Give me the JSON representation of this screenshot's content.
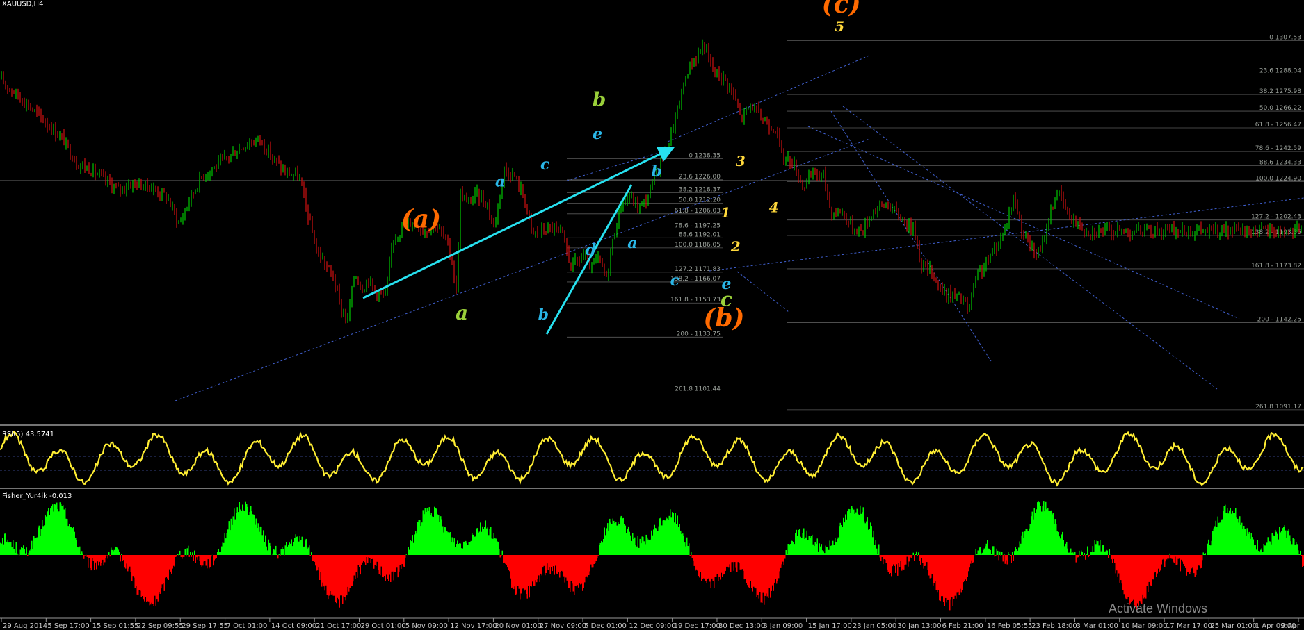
{
  "window": {
    "symbol_title": "XAUUSD,H4"
  },
  "colors": {
    "background": "#000000",
    "bull_candle": "#00c800",
    "bear_candle": "#d01010",
    "fib_line": "#5a5a5a",
    "trend_dotted": "#4060d0",
    "cyan_arrow": "#27e1f0",
    "rsi_line": "#ffee33",
    "fisher_up": "#00ff00",
    "fisher_down": "#ff0000",
    "wave_orange": "#ff6a00",
    "wave_green": "#9ad03a",
    "wave_cyan": "#2ab7e8",
    "wave_yellow": "#ffd83c"
  },
  "chart_data": [
    {
      "type": "candlestick",
      "title": "XAUUSD,H4",
      "xlabel": "",
      "ylabel": "",
      "x_tick_labels": [
        "29 Aug 2014",
        "5 Sep 17:00",
        "15 Sep 01:55",
        "22 Sep 09:55",
        "29 Sep 17:55",
        "7 Oct 01:00",
        "14 Oct 09:00",
        "21 Oct 17:00",
        "29 Oct 01:00",
        "5 Nov 09:00",
        "12 Nov 17:00",
        "20 Nov 01:00",
        "27 Nov 09:00",
        "5 Dec 01:00",
        "12 Dec 09:00",
        "19 Dec 17:00",
        "30 Dec 13:00",
        "8 Jan 09:00",
        "15 Jan 17:00",
        "23 Jan 05:00",
        "30 Jan 13:00",
        "6 Feb 21:00",
        "16 Feb 05:55",
        "23 Feb 18:00",
        "3 Mar 01:00",
        "10 Mar 09:00",
        "17 Mar 17:00",
        "25 Mar 01:00",
        "1 Apr 09:00",
        "9 Apr"
      ],
      "y_range": [
        1085,
        1320
      ],
      "price_path": [
        {
          "x": 0,
          "y": 1285
        },
        {
          "x": 35,
          "y": 1272
        },
        {
          "x": 50,
          "y": 1266
        },
        {
          "x": 70,
          "y": 1258
        },
        {
          "x": 90,
          "y": 1250
        },
        {
          "x": 110,
          "y": 1236
        },
        {
          "x": 130,
          "y": 1232
        },
        {
          "x": 150,
          "y": 1226
        },
        {
          "x": 170,
          "y": 1220
        },
        {
          "x": 190,
          "y": 1224
        },
        {
          "x": 215,
          "y": 1222
        },
        {
          "x": 240,
          "y": 1216
        },
        {
          "x": 258,
          "y": 1200
        },
        {
          "x": 272,
          "y": 1214
        },
        {
          "x": 290,
          "y": 1228
        },
        {
          "x": 310,
          "y": 1234
        },
        {
          "x": 330,
          "y": 1240
        },
        {
          "x": 350,
          "y": 1246
        },
        {
          "x": 373,
          "y": 1250
        },
        {
          "x": 390,
          "y": 1240
        },
        {
          "x": 410,
          "y": 1230
        },
        {
          "x": 430,
          "y": 1228
        },
        {
          "x": 440,
          "y": 1210
        },
        {
          "x": 455,
          "y": 1185
        },
        {
          "x": 470,
          "y": 1175
        },
        {
          "x": 480,
          "y": 1168
        },
        {
          "x": 490,
          "y": 1150
        },
        {
          "x": 500,
          "y": 1144
        },
        {
          "x": 510,
          "y": 1172
        },
        {
          "x": 520,
          "y": 1162
        },
        {
          "x": 530,
          "y": 1168
        },
        {
          "x": 540,
          "y": 1160
        },
        {
          "x": 555,
          "y": 1158
        },
        {
          "x": 565,
          "y": 1192
        },
        {
          "x": 580,
          "y": 1198
        },
        {
          "x": 595,
          "y": 1202
        },
        {
          "x": 610,
          "y": 1196
        },
        {
          "x": 625,
          "y": 1200
        },
        {
          "x": 640,
          "y": 1192
        },
        {
          "x": 650,
          "y": 1178
        },
        {
          "x": 656,
          "y": 1160
        },
        {
          "x": 662,
          "y": 1218
        },
        {
          "x": 672,
          "y": 1212
        },
        {
          "x": 685,
          "y": 1218
        },
        {
          "x": 700,
          "y": 1212
        },
        {
          "x": 710,
          "y": 1198
        },
        {
          "x": 725,
          "y": 1232
        },
        {
          "x": 740,
          "y": 1228
        },
        {
          "x": 755,
          "y": 1214
        },
        {
          "x": 765,
          "y": 1194
        },
        {
          "x": 780,
          "y": 1196
        },
        {
          "x": 795,
          "y": 1198
        },
        {
          "x": 810,
          "y": 1192
        },
        {
          "x": 820,
          "y": 1176
        },
        {
          "x": 830,
          "y": 1178
        },
        {
          "x": 840,
          "y": 1182
        },
        {
          "x": 850,
          "y": 1174
        },
        {
          "x": 860,
          "y": 1180
        },
        {
          "x": 872,
          "y": 1168
        },
        {
          "x": 880,
          "y": 1188
        },
        {
          "x": 893,
          "y": 1212
        },
        {
          "x": 905,
          "y": 1216
        },
        {
          "x": 918,
          "y": 1210
        },
        {
          "x": 930,
          "y": 1214
        },
        {
          "x": 945,
          "y": 1232
        },
        {
          "x": 960,
          "y": 1246
        },
        {
          "x": 975,
          "y": 1268
        },
        {
          "x": 990,
          "y": 1292
        },
        {
          "x": 1005,
          "y": 1300
        },
        {
          "x": 1012,
          "y": 1306
        },
        {
          "x": 1025,
          "y": 1290
        },
        {
          "x": 1040,
          "y": 1286
        },
        {
          "x": 1055,
          "y": 1276
        },
        {
          "x": 1065,
          "y": 1262
        },
        {
          "x": 1080,
          "y": 1270
        },
        {
          "x": 1095,
          "y": 1262
        },
        {
          "x": 1115,
          "y": 1256
        },
        {
          "x": 1125,
          "y": 1240
        },
        {
          "x": 1140,
          "y": 1236
        },
        {
          "x": 1155,
          "y": 1222
        },
        {
          "x": 1170,
          "y": 1230
        },
        {
          "x": 1185,
          "y": 1228
        },
        {
          "x": 1195,
          "y": 1206
        },
        {
          "x": 1210,
          "y": 1208
        },
        {
          "x": 1225,
          "y": 1198
        },
        {
          "x": 1240,
          "y": 1196
        },
        {
          "x": 1255,
          "y": 1208
        },
        {
          "x": 1275,
          "y": 1212
        },
        {
          "x": 1295,
          "y": 1204
        },
        {
          "x": 1315,
          "y": 1196
        },
        {
          "x": 1325,
          "y": 1176
        },
        {
          "x": 1340,
          "y": 1172
        },
        {
          "x": 1355,
          "y": 1160
        },
        {
          "x": 1370,
          "y": 1158
        },
        {
          "x": 1385,
          "y": 1156
        },
        {
          "x": 1392,
          "y": 1148
        },
        {
          "x": 1405,
          "y": 1170
        },
        {
          "x": 1420,
          "y": 1178
        },
        {
          "x": 1440,
          "y": 1192
        },
        {
          "x": 1458,
          "y": 1216
        },
        {
          "x": 1470,
          "y": 1196
        },
        {
          "x": 1485,
          "y": 1184
        },
        {
          "x": 1495,
          "y": 1182
        },
        {
          "x": 1510,
          "y": 1206
        },
        {
          "x": 1520,
          "y": 1220
        },
        {
          "x": 1535,
          "y": 1206
        },
        {
          "x": 1550,
          "y": 1200
        },
        {
          "x": 1565,
          "y": 1196
        }
      ],
      "fib_retracements": [
        {
          "levels": [
            {
              "text": "0 1238.35",
              "price": 1238.35
            },
            {
              "text": "23.6 1226.00",
              "price": 1226.0
            },
            {
              "text": "38.2 1218.37",
              "price": 1218.37
            },
            {
              "text": "50.0 1212.20",
              "price": 1212.2
            },
            {
              "text": "61.8 - 1206.03",
              "price": 1206.03
            },
            {
              "text": "78.6 - 1197.25",
              "price": 1197.25
            },
            {
              "text": "88.6 1192.01",
              "price": 1192.01
            },
            {
              "text": "100.0 1186.05",
              "price": 1186.05
            },
            {
              "text": "127.2 1171.83",
              "price": 1171.83
            },
            {
              "text": "138.2 - 1166.07",
              "price": 1166.07
            },
            {
              "text": "161.8 - 1153.73",
              "price": 1153.73
            },
            {
              "text": "200 - 1133.75",
              "price": 1133.75
            },
            {
              "text": "261.8 1101.44",
              "price": 1101.44
            }
          ]
        },
        {
          "levels": [
            {
              "text": "0 1307.53",
              "price": 1307.53
            },
            {
              "text": "23.6 1288.04",
              "price": 1288.04
            },
            {
              "text": "38.2 1275.98",
              "price": 1275.98
            },
            {
              "text": "50.0 1266.22",
              "price": 1266.22
            },
            {
              "text": "61.8 - 1256.47",
              "price": 1256.47
            },
            {
              "text": "78.6 - 1242.59",
              "price": 1242.59
            },
            {
              "text": "88.6 1234.33",
              "price": 1234.33
            },
            {
              "text": "100.0 1224.90",
              "price": 1224.9
            },
            {
              "text": "127.2 - 1202.43",
              "price": 1202.43
            },
            {
              "text": "138.2 - 1193.35",
              "price": 1193.35
            },
            {
              "text": "161.8 - 1173.82",
              "price": 1173.82
            },
            {
              "text": "200 - 1142.25",
              "price": 1142.25
            },
            {
              "text": "261.8 1091.17",
              "price": 1091.17
            }
          ]
        }
      ],
      "wave_labels": [
        {
          "text": "(a)",
          "color": "#ff6a00",
          "x": 506,
          "y": 1198
        },
        {
          "text": "(b)",
          "color": "#ff6a00",
          "x": 870,
          "y": 1140
        },
        {
          "text": "(c)",
          "color": "#ff6a00",
          "x": 1011,
          "y": 1324
        },
        {
          "text": "a",
          "color": "#9ad03a",
          "x": 555,
          "y": 1144
        },
        {
          "text": "b",
          "color": "#9ad03a",
          "x": 720,
          "y": 1269
        },
        {
          "text": "c",
          "color": "#9ad03a",
          "x": 873,
          "y": 1152
        },
        {
          "text": "a",
          "color": "#2ab7e8",
          "x": 601,
          "y": 1222
        },
        {
          "text": "b",
          "color": "#2ab7e8",
          "x": 653,
          "y": 1144
        },
        {
          "text": "c",
          "color": "#2ab7e8",
          "x": 655,
          "y": 1232
        },
        {
          "text": "d",
          "color": "#2ab7e8",
          "x": 710,
          "y": 1182
        },
        {
          "text": "e",
          "color": "#2ab7e8",
          "x": 718,
          "y": 1250
        },
        {
          "text": "a",
          "color": "#2ab7e8",
          "x": 760,
          "y": 1186
        },
        {
          "text": "b",
          "color": "#2ab7e8",
          "x": 789,
          "y": 1228
        },
        {
          "text": "c",
          "color": "#2ab7e8",
          "x": 811,
          "y": 1164
        },
        {
          "text": "e",
          "color": "#2ab7e8",
          "x": 873,
          "y": 1162
        },
        {
          "text": "1",
          "color": "#ffd83c",
          "x": 872,
          "y": 1204
        },
        {
          "text": "2",
          "color": "#ffd83c",
          "x": 884,
          "y": 1184
        },
        {
          "text": "3",
          "color": "#ffd83c",
          "x": 890,
          "y": 1234
        },
        {
          "text": "4",
          "color": "#ffd83c",
          "x": 930,
          "y": 1207
        },
        {
          "text": "5",
          "color": "#ffd83c",
          "x": 1009,
          "y": 1313
        }
      ]
    },
    {
      "type": "line",
      "title": "RSI(5) 43.5741",
      "series": [
        {
          "name": "RSI(5) 43.5741"
        }
      ],
      "ylim": [
        0,
        100
      ],
      "shape": "oscillating"
    },
    {
      "type": "bar",
      "title": "Fisher_Yur4ik -0.013",
      "series": [
        {
          "name": "Fisher_Yur4ik -0.013"
        }
      ],
      "ylim": [
        -1,
        1
      ],
      "shape": "histogram"
    }
  ],
  "watermark": {
    "line1": "Activate Windows"
  }
}
